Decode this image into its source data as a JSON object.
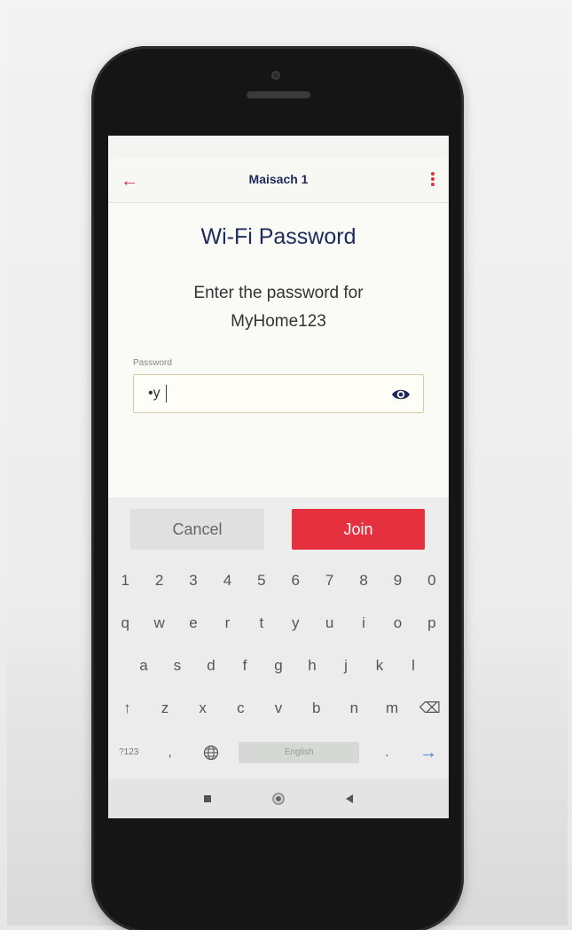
{
  "app_bar": {
    "title": "Maisach 1",
    "back_icon": "arrow-left-icon",
    "menu_icon": "kebab-menu-icon"
  },
  "page": {
    "heading": "Wi-Fi Password",
    "prompt_line1": "Enter the password for",
    "prompt_line2": "MyHome123"
  },
  "password": {
    "label": "Password",
    "value": "•y",
    "visibility_icon": "eye-icon"
  },
  "actions": {
    "cancel_label": "Cancel",
    "join_label": "Join"
  },
  "keyboard": {
    "row_numbers": [
      "1",
      "2",
      "3",
      "4",
      "5",
      "6",
      "7",
      "8",
      "9",
      "0"
    ],
    "row_top": [
      "q",
      "w",
      "e",
      "r",
      "t",
      "y",
      "u",
      "i",
      "o",
      "p"
    ],
    "row_home": [
      "a",
      "s",
      "d",
      "f",
      "g",
      "h",
      "j",
      "k",
      "l"
    ],
    "row_bottom": [
      "↑",
      "z",
      "x",
      "c",
      "v",
      "b",
      "n",
      "m",
      "⌫"
    ],
    "symbols_label": "?123",
    "comma_label": ",",
    "globe_icon": "globe-icon",
    "space_label": "English",
    "period_label": ".",
    "enter_glyph": "→"
  },
  "navbar": {
    "recents_icon": "square-icon",
    "home_icon": "circle-icon",
    "back_icon": "triangle-back-icon"
  },
  "colors": {
    "accent": "#e53040",
    "title": "#1f2a5c"
  }
}
